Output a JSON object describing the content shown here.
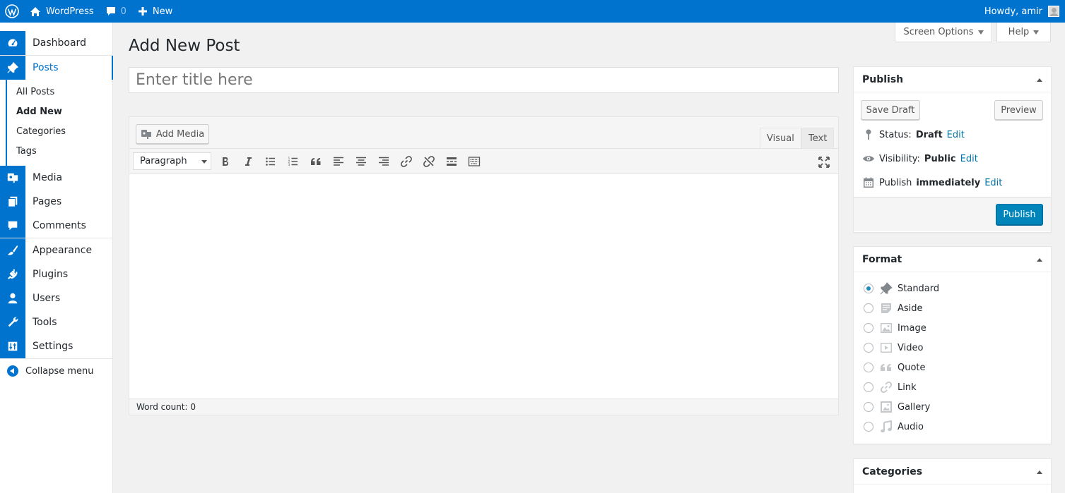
{
  "admin_bar": {
    "site_name": "WordPress",
    "comments_count": "0",
    "new_label": "New",
    "howdy": "Howdy, amir"
  },
  "sidebar": {
    "dashboard": "Dashboard",
    "posts": "Posts",
    "posts_submenu": [
      "All Posts",
      "Add New",
      "Categories",
      "Tags"
    ],
    "media": "Media",
    "pages": "Pages",
    "comments": "Comments",
    "appearance": "Appearance",
    "plugins": "Plugins",
    "users": "Users",
    "tools": "Tools",
    "settings": "Settings",
    "collapse": "Collapse menu"
  },
  "screen_meta": {
    "screen_options": "Screen Options",
    "help": "Help"
  },
  "page": {
    "title": "Add New Post",
    "title_placeholder": "Enter title here"
  },
  "editor": {
    "add_media": "Add Media",
    "tab_visual": "Visual",
    "tab_text": "Text",
    "format_value": "Paragraph",
    "word_count": "Word count: 0"
  },
  "publish_box": {
    "title": "Publish",
    "save_draft": "Save Draft",
    "preview": "Preview",
    "status_label": "Status:",
    "status_value": "Draft",
    "visibility_label": "Visibility:",
    "visibility_value": "Public",
    "publish_label": "Publish",
    "publish_value": "immediately",
    "edit": "Edit",
    "publish_button": "Publish"
  },
  "format_box": {
    "title": "Format",
    "options": [
      "Standard",
      "Aside",
      "Image",
      "Video",
      "Quote",
      "Link",
      "Gallery",
      "Audio"
    ],
    "selected": "Standard"
  },
  "categories_box": {
    "title": "Categories"
  },
  "colors": {
    "admin_bar": "#0073cf",
    "accent": "#0073aa",
    "primary_button": "#0085ba"
  }
}
